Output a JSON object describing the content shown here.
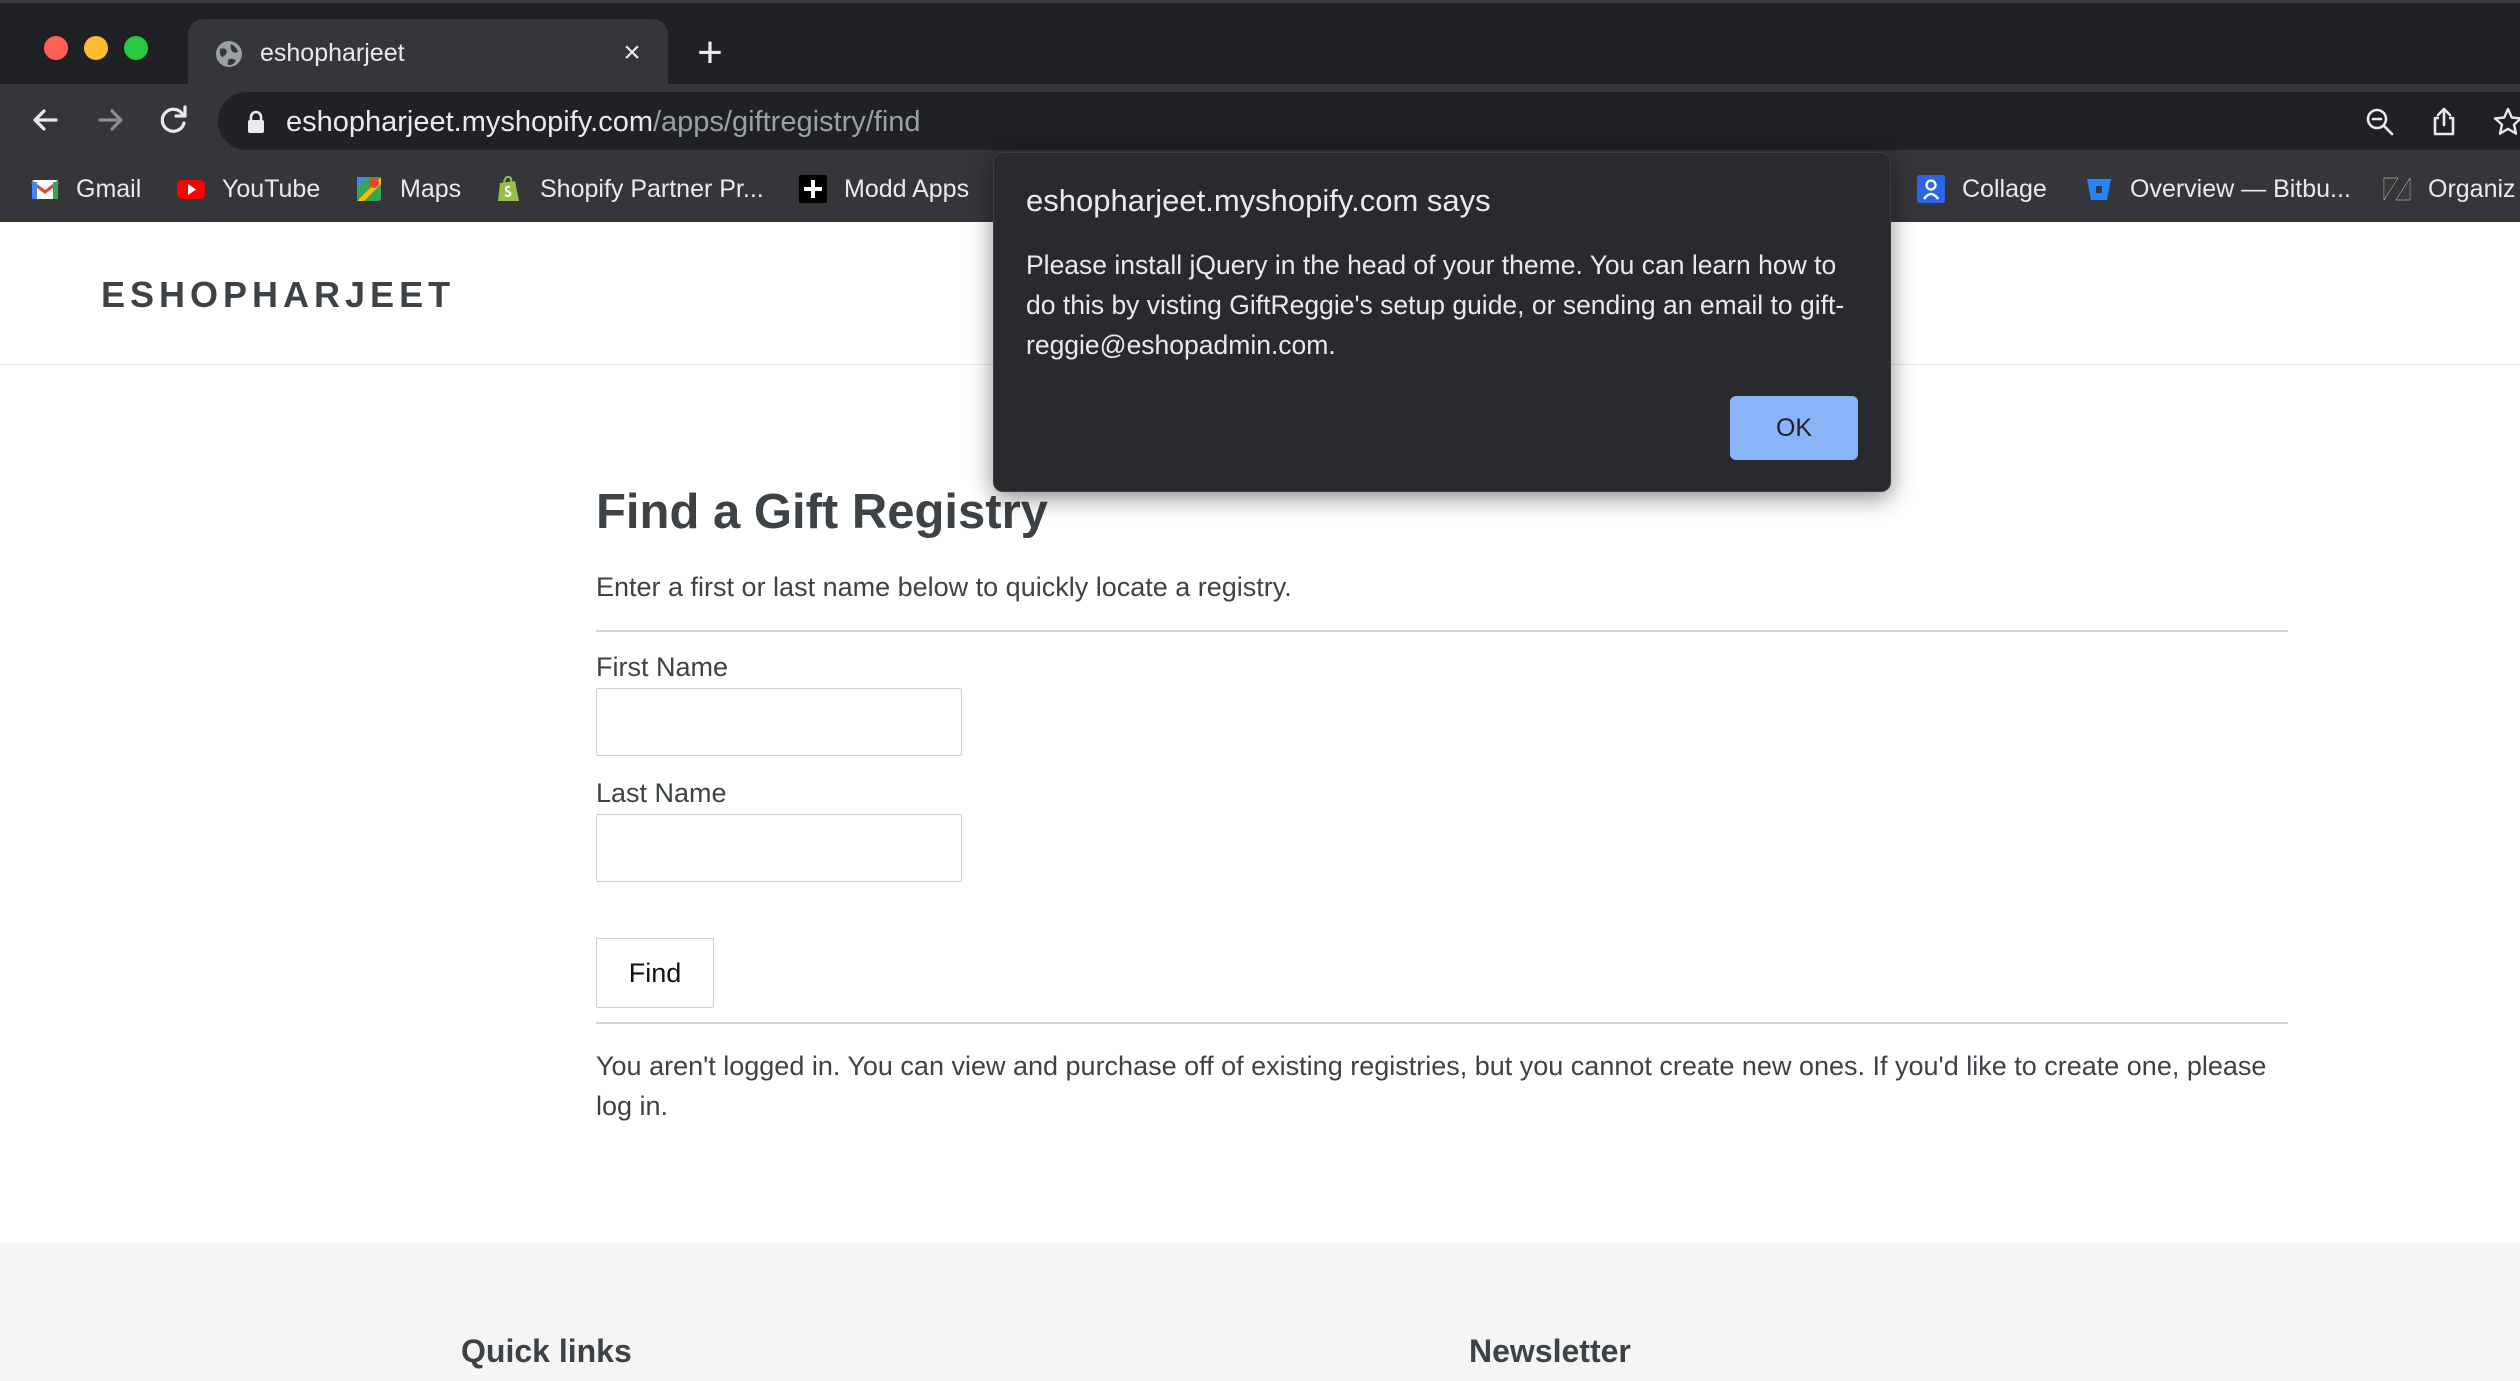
{
  "browser": {
    "tab": {
      "title": "eshopharjeet",
      "close_glyph": "×"
    },
    "new_tab_glyph": "+",
    "address": {
      "host": "eshopharjeet.myshopify.com",
      "path": "/apps/giftregistry/find"
    },
    "bookmarks": [
      {
        "label": "Gmail",
        "icon": "gmail-icon"
      },
      {
        "label": "YouTube",
        "icon": "youtube-icon"
      },
      {
        "label": "Maps",
        "icon": "maps-icon"
      },
      {
        "label": "Shopify Partner Pr...",
        "icon": "shopify-icon"
      },
      {
        "label": "Modd Apps",
        "icon": "plus-icon"
      },
      {
        "label": "Collage",
        "icon": "collage-icon"
      },
      {
        "label": "Overview — Bitbu...",
        "icon": "bitbucket-icon"
      },
      {
        "label": "Organiz",
        "icon": "zendesk-icon"
      }
    ]
  },
  "site": {
    "logo": "ESHOPHARJEET",
    "page_title": "Find a Gift Registry",
    "intro": "Enter a first or last name below to quickly locate a registry.",
    "form": {
      "first_name_label": "First Name",
      "first_name_value": "",
      "last_name_label": "Last Name",
      "last_name_value": "",
      "find_button": "Find"
    },
    "login_notice": "You aren't logged in. You can view and purchase off of existing registries, but you cannot create new ones. If you'd like to create one, please log in.",
    "footer": {
      "quick_links": "Quick links",
      "newsletter": "Newsletter"
    }
  },
  "dialog": {
    "title": "eshopharjeet.myshopify.com says",
    "message": "Please install jQuery in the head of your theme. You can learn how to do this by visting GiftReggie's setup guide, or sending an email to gift-reggie@eshopadmin.com.",
    "ok_button": "OK"
  },
  "colors": {
    "chrome_dark": "#202124",
    "chrome_toolbar": "#35363a",
    "dialog_bg": "#292a2d",
    "dialog_button": "#8ab4f8",
    "page_text": "#3d4246"
  }
}
